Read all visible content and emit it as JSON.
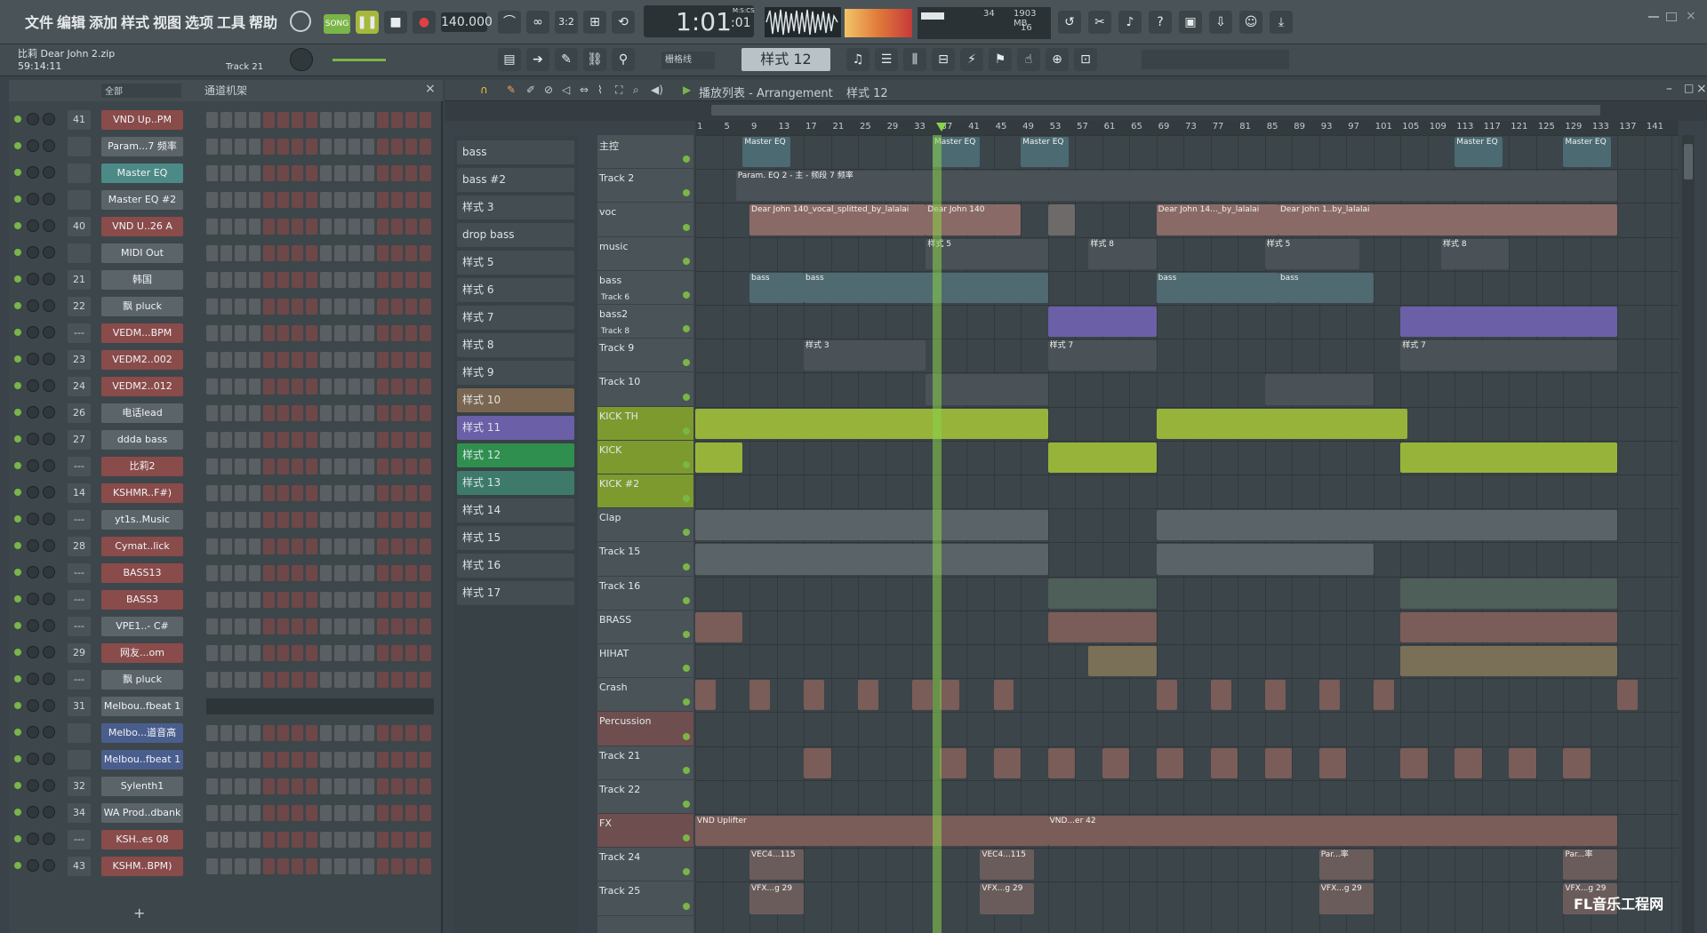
{
  "menu": [
    "文件",
    "编辑",
    "添加",
    "样式",
    "视图",
    "选项",
    "工具",
    "帮助"
  ],
  "transport": {
    "mode": "SONG",
    "tempo": "140.000",
    "time": "1:01",
    "time_small": ":01",
    "time_label": "M:S:CS",
    "cpu_val": "34",
    "mem": "1903 MB",
    "poly": "16"
  },
  "project": {
    "name": "比莉 Dear John 2.zip",
    "time": "59:14:11",
    "hint": "Track 21"
  },
  "toolbar2": {
    "snap": "栅格线",
    "pattern": "样式 12"
  },
  "chrack": {
    "filter": "全部",
    "title": "通道机架"
  },
  "channels": [
    {
      "num": "41",
      "name": "VND Up..PM",
      "color": "red"
    },
    {
      "num": "",
      "name": "Param...7 频率",
      "color": ""
    },
    {
      "num": "",
      "name": "Master EQ",
      "color": "teal"
    },
    {
      "num": "",
      "name": "Master EQ #2",
      "color": ""
    },
    {
      "num": "40",
      "name": "VND U..26 A",
      "color": "red"
    },
    {
      "num": "",
      "name": "MIDI Out",
      "color": ""
    },
    {
      "num": "21",
      "name": "韩国",
      "color": ""
    },
    {
      "num": "22",
      "name": "飘 pluck",
      "color": ""
    },
    {
      "num": "---",
      "name": "VEDM...BPM",
      "color": "red"
    },
    {
      "num": "23",
      "name": "VEDM2..002",
      "color": "red"
    },
    {
      "num": "24",
      "name": "VEDM2..012",
      "color": "red"
    },
    {
      "num": "26",
      "name": "电话lead",
      "color": ""
    },
    {
      "num": "27",
      "name": "ddda bass",
      "color": ""
    },
    {
      "num": "---",
      "name": "比莉2",
      "color": "red"
    },
    {
      "num": "14",
      "name": "KSHMR..F#)",
      "color": "red"
    },
    {
      "num": "---",
      "name": "yt1s..Music",
      "color": ""
    },
    {
      "num": "28",
      "name": "Cymat..lick",
      "color": "red"
    },
    {
      "num": "---",
      "name": "BASS13",
      "color": "red"
    },
    {
      "num": "---",
      "name": "BASS3",
      "color": "red"
    },
    {
      "num": "---",
      "name": "VPE1..- C#",
      "color": ""
    },
    {
      "num": "29",
      "name": "网友...om",
      "color": "red"
    },
    {
      "num": "---",
      "name": "飘 pluck",
      "color": ""
    },
    {
      "num": "31",
      "name": "Melbou..fbeat 1",
      "color": ""
    },
    {
      "num": "",
      "name": "Melbo...道音高",
      "color": "blue"
    },
    {
      "num": "",
      "name": "Melbou..fbeat 1",
      "color": "blue"
    },
    {
      "num": "32",
      "name": "Sylenth1",
      "color": ""
    },
    {
      "num": "34",
      "name": "WA Prod..dbank",
      "color": ""
    },
    {
      "num": "---",
      "name": "KSH..es 08",
      "color": "red"
    },
    {
      "num": "43",
      "name": "KSHM..BPM)",
      "color": "red"
    }
  ],
  "playlist": {
    "title": "播放列表 - Arrangement",
    "pattern": "样式 12"
  },
  "patterns": [
    "bass",
    "bass #2",
    "样式 3",
    "drop bass",
    "样式 5",
    "样式 6",
    "样式 7",
    "样式 8",
    "样式 9",
    "样式 10",
    "样式 11",
    "样式 12",
    "样式 13",
    "样式 14",
    "样式 15",
    "样式 16",
    "样式 17"
  ],
  "tracks": [
    "主控",
    "Track 2",
    "voc",
    "music",
    "bass",
    "bass2",
    "Track 9",
    "Track 10",
    "KICK TH",
    "KICK",
    "KICK #2",
    "Clap",
    "Track 15",
    "Track 16",
    "BRASS",
    "HIHAT",
    "Crash",
    "Percussion",
    "Track 21",
    "Track 22",
    "FX",
    "Track 24",
    "Track 25"
  ],
  "track_sub": {
    "bass": "Track 6",
    "bass2": "Track 8"
  },
  "ruler": [
    "1",
    "5",
    "9",
    "13",
    "17",
    "21",
    "25",
    "29",
    "33",
    "37",
    "41",
    "45",
    "49",
    "53",
    "57",
    "61",
    "65",
    "69",
    "73",
    "77",
    "81",
    "85",
    "89",
    "93",
    "97",
    "101",
    "105",
    "109",
    "113",
    "117",
    "121",
    "125",
    "129",
    "133",
    "137",
    "141"
  ],
  "clips": {
    "master_eq": "Master EQ",
    "param_eq": "Param. EQ 2 - 主 - 频段 7 频率",
    "voc1": "Dear John 140_vocal_splitted_by_lalalai",
    "voc2": "Dear John 140",
    "voc3": "Dear John 14..._by_lalalai",
    "voc4": "Dear John 1..by_lalalai",
    "music1": "样式 5",
    "music2": "样式 8",
    "music3": "样式 5",
    "music4": "样式 8",
    "bass": "bass",
    "t9a": "样式 3",
    "t9b": "样式 7",
    "fx": "VND Uplifter",
    "fx2": "VND...er 42",
    "vec": "VEC4...115",
    "par": "Par...率",
    "vfx": "VFX...g 29"
  },
  "watermark": "FL音乐工程网",
  "colors": {
    "accent": "#7ab547",
    "highlight": "#2f8f4f",
    "playhead": "#8bd24a"
  }
}
